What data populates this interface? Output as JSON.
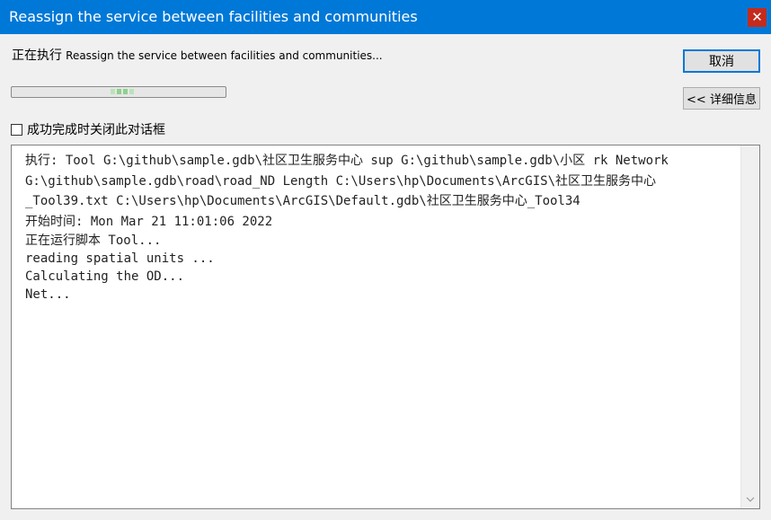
{
  "window": {
    "title": "Reassign the service between facilities and communities",
    "close_glyph": "✕"
  },
  "status": {
    "prefix": "正在执行",
    "tool_name": "Reassign the service between facilities and communities..."
  },
  "progress": {
    "state": "indeterminate"
  },
  "buttons": {
    "cancel_label": "取消",
    "details_label": "<< 详细信息"
  },
  "close_on_complete": {
    "label": "成功完成时关闭此对话框",
    "checked": false
  },
  "log": {
    "lines": [
      "执行: Tool G:\\github\\sample.gdb\\社区卫生服务中心 sup G:\\github\\sample.gdb\\小区 rk Network",
      "G:\\github\\sample.gdb\\road\\road_ND Length C:\\Users\\hp\\Documents\\ArcGIS\\社区卫生服务中心",
      "_Tool39.txt C:\\Users\\hp\\Documents\\ArcGIS\\Default.gdb\\社区卫生服务中心_Tool34",
      "开始时间: Mon Mar 21 11:01:06 2022",
      "正在运行脚本 Tool...",
      "reading spatial units ...",
      "Calculating the OD...",
      "Net..."
    ]
  },
  "icons": {
    "close": "close-icon",
    "scroll_down": "chevron-down-icon"
  },
  "colors": {
    "titlebar": "#0078d7",
    "close_button": "#c42b1c",
    "progress_fill": "#8fd18f"
  }
}
